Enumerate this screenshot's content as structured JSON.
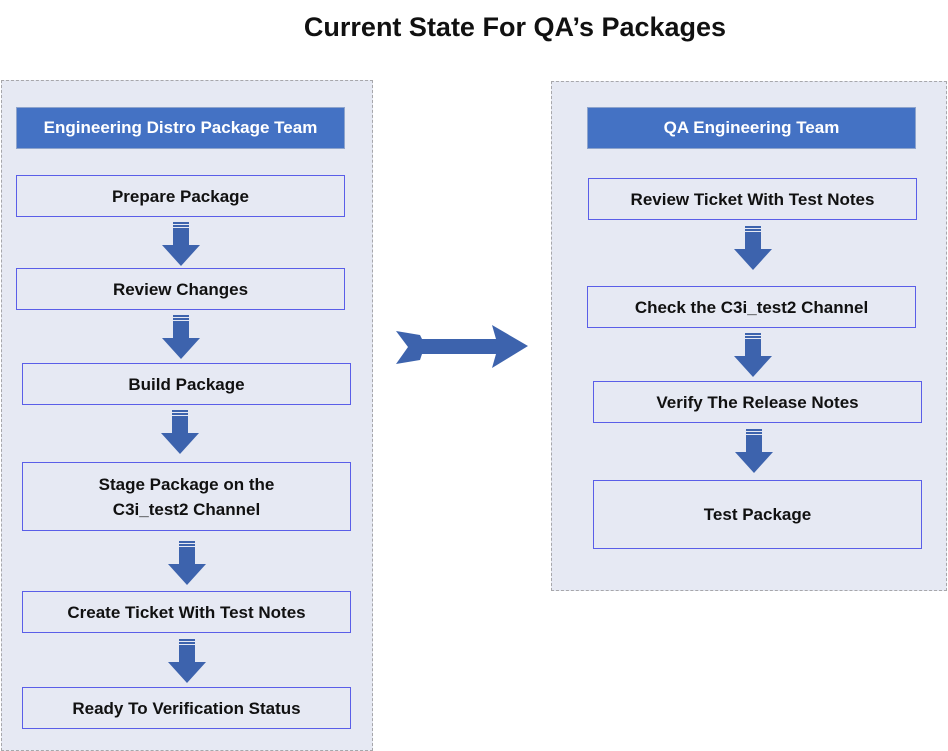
{
  "title": "Current State For QA’s Packages",
  "colors": {
    "accent": "#4472c4",
    "arrow": "#3d63ad",
    "lane_bg": "#e6e9f3",
    "step_border": "#5a5ee8"
  },
  "lanes": [
    {
      "header": "Engineering Distro Package Team",
      "steps": [
        "Prepare Package",
        "Review Changes",
        "Build Package",
        "Stage Package on the C3i_test2 Channel",
        "Create Ticket With Test Notes",
        "Ready To Verification Status"
      ]
    },
    {
      "header": "QA Engineering Team",
      "steps": [
        "Review Ticket With Test Notes",
        "Check the C3i_test2 Channel",
        "Verify The Release Notes",
        "Test Package"
      ]
    }
  ],
  "connector": {
    "icon": "right-arrow-icon"
  },
  "step_icon": "down-arrow-icon"
}
